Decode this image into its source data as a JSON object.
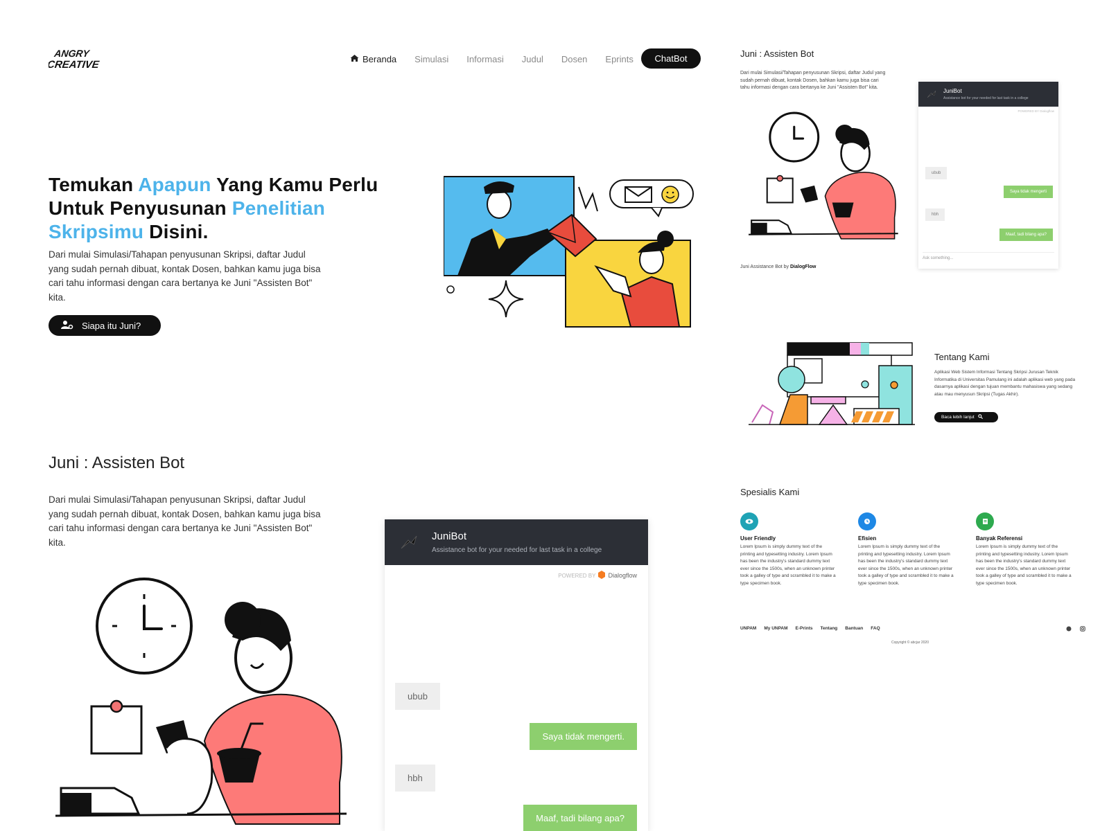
{
  "brand": {
    "logo_text": "ANGRY CREATIVE"
  },
  "nav": {
    "items": [
      {
        "label": "Beranda",
        "icon": "home-icon",
        "active": true
      },
      {
        "label": "Simulasi"
      },
      {
        "label": "Informasi"
      },
      {
        "label": "Judul"
      },
      {
        "label": "Dosen"
      },
      {
        "label": "Eprints"
      }
    ],
    "cta": "ChatBot"
  },
  "hero": {
    "title_parts": [
      "Temukan ",
      "Apapun",
      " Yang Kamu Perlu Untuk Penyusunan ",
      "Penelitian",
      " ",
      "Skripsimu",
      " Disini."
    ],
    "description": "Dari mulai Simulasi/Tahapan penyusunan Skripsi, daftar Judul yang sudah pernah dibuat, kontak Dosen, bahkan kamu juga bisa cari tahu informasi dengan cara bertanya ke Juni \"Assisten Bot\" kita.",
    "button": "Siapa itu Juni?",
    "accent_color": "#4db3ea"
  },
  "assistant_section": {
    "title": "Juni : Assisten Bot",
    "description": "Dari mulai Simulasi/Tahapan penyusunan Skripsi, daftar Judul yang sudah pernah dibuat, kontak Dosen, bahkan kamu juga bisa cari tahu informasi dengan cara bertanya ke Juni \"Assisten Bot\" kita."
  },
  "chat": {
    "name": "JuniBot",
    "subtitle": "Assistance bot for your needed for last task in a college",
    "powered_by": "POWERED BY",
    "provider": "Dialogflow",
    "messages": [
      {
        "from": "user",
        "text": "ubub"
      },
      {
        "from": "bot",
        "text": "Saya tidak mengerti."
      },
      {
        "from": "user",
        "text": "hbh"
      },
      {
        "from": "bot",
        "text": "Maaf, tadi bilang apa?"
      }
    ],
    "input_placeholder": "Ask something...",
    "header_color": "#2c2f36",
    "bot_bubble_color": "#8dcf6e"
  },
  "right_preview": {
    "title": "Juni : Assisten Bot",
    "description": "Dari mulai Simulasi/Tahapan penyusunan Skripsi, daftar Judul yang sudah pernah dibuat, kontak Dosen, bahkan kamu juga bisa cari tahu informasi dengan cara bertanya ke Juni \"Assisten Bot\" kita.",
    "credit_prefix": "Juni Assistance Bot by ",
    "credit_brand": "DialogFlow",
    "mini_bot_messages": [
      "Saya tidak mengerti",
      "Maaf, tadi bilang apa?"
    ]
  },
  "tentang": {
    "title": "Tentang Kami",
    "description": "Aplikasi Web Sistem Informasi Tentang Skripsi Jurusan Teknik Informatika di Universitas Pamulang ini adalah aplikasi web yang pada dasarnya aplikasi dengan tujuan membantu mahasiswa yang sedang atau mau menyusun Skripsi (Tugas Akhir).",
    "button": "Baca lebih lanjut"
  },
  "spesialis": {
    "title": "Spesialis Kami",
    "items": [
      {
        "name": "User Friendly",
        "icon": "eye-icon",
        "color": "#1fa3b5",
        "text": "Lorem Ipsum is simply dummy text of the printing and typesetting industry. Lorem Ipsum has been the industry's standard dummy text ever since the 1500s, when an unknown printer took a galley of type and scrambled it to make a type specimen book."
      },
      {
        "name": "Efisien",
        "icon": "clock-icon",
        "color": "#1e88e5",
        "text": "Lorem Ipsum is simply dummy text of the printing and typesetting industry. Lorem Ipsum has been the industry's standard dummy text ever since the 1500s, when an unknown printer took a galley of type and scrambled it to make a type specimen book."
      },
      {
        "name": "Banyak Referensi",
        "icon": "book-icon",
        "color": "#2eaa4f",
        "text": "Lorem Ipsum is simply dummy text of the printing and typesetting industry. Lorem Ipsum has been the industry's standard dummy text ever since the 1500s, when an unknown printer took a galley of type and scrambled it to make a type specimen book."
      }
    ]
  },
  "footer": {
    "links": [
      "UNPAM",
      "My UNPAM",
      "E-Prints",
      "Tentang",
      "Bantuan",
      "FAQ"
    ],
    "copyright": "Copyright © abcjar 2020"
  }
}
